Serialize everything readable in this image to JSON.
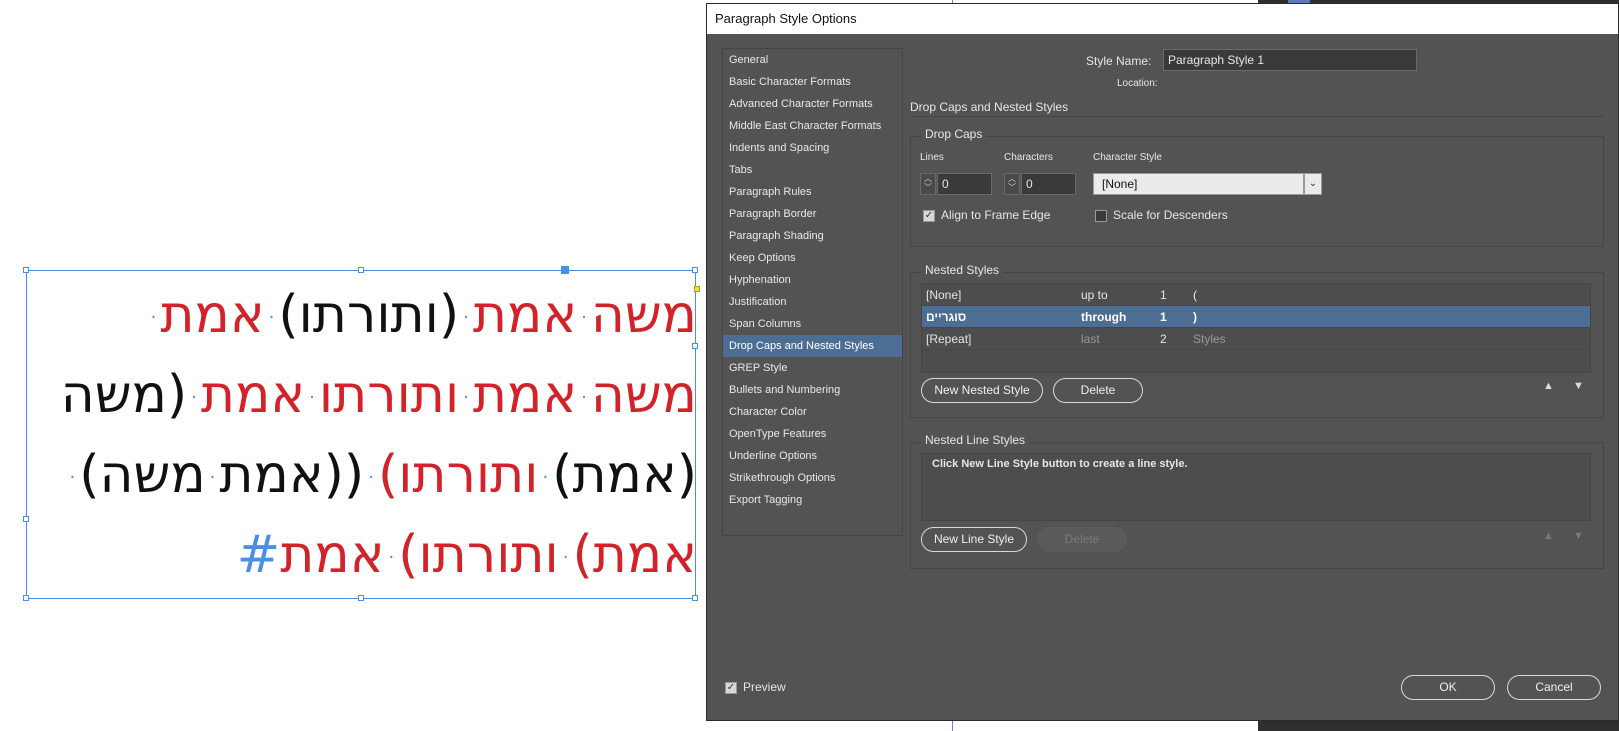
{
  "document": {
    "hebrew_lines": [
      [
        {
          "t": "משה",
          "c": "red"
        },
        {
          "t": "·",
          "c": "dot"
        },
        {
          "t": "אמת",
          "c": "red"
        },
        {
          "t": "·",
          "c": "dot"
        },
        {
          "t": "(ותורתו)",
          "c": "black"
        },
        {
          "t": "·",
          "c": "dot"
        },
        {
          "t": "אמת",
          "c": "red"
        },
        {
          "t": "·",
          "c": "dot"
        }
      ],
      [
        {
          "t": "משה",
          "c": "red"
        },
        {
          "t": "·",
          "c": "dot"
        },
        {
          "t": "אמת",
          "c": "red"
        },
        {
          "t": "·",
          "c": "dot"
        },
        {
          "t": "ותורתו",
          "c": "red"
        },
        {
          "t": "·",
          "c": "dot"
        },
        {
          "t": "אמת",
          "c": "red"
        },
        {
          "t": "·",
          "c": "dot"
        },
        {
          "t": "(משה",
          "c": "black"
        }
      ],
      [
        {
          "t": "(אמת)",
          "c": "black"
        },
        {
          "t": "·",
          "c": "dot"
        },
        {
          "t": "ותורתו)",
          "c": "red"
        },
        {
          "t": "·",
          "c": "dot"
        },
        {
          "t": "((אמת",
          "c": "black"
        },
        {
          "t": "·",
          "c": "dot"
        },
        {
          "t": "משה)",
          "c": "black"
        },
        {
          "t": "·",
          "c": "dot"
        }
      ],
      [
        {
          "t": "אמת)",
          "c": "red"
        },
        {
          "t": "·",
          "c": "dot"
        },
        {
          "t": "ותורתו)",
          "c": "red"
        },
        {
          "t": "·",
          "c": "dot"
        },
        {
          "t": "אמת",
          "c": "red"
        },
        {
          "t": "#",
          "c": "hash"
        }
      ]
    ]
  },
  "dialog": {
    "title": "Paragraph Style Options",
    "style_name_label": "Style Name:",
    "style_name_value": "Paragraph Style 1",
    "location_label": "Location:",
    "section_heading": "Drop Caps and Nested Styles",
    "categories": [
      "General",
      "Basic Character Formats",
      "Advanced Character Formats",
      "Middle East Character Formats",
      "Indents and Spacing",
      "Tabs",
      "Paragraph Rules",
      "Paragraph Border",
      "Paragraph Shading",
      "Keep Options",
      "Hyphenation",
      "Justification",
      "Span Columns",
      "Drop Caps and Nested Styles",
      "GREP Style",
      "Bullets and Numbering",
      "Character Color",
      "OpenType Features",
      "Underline Options",
      "Strikethrough Options",
      "Export Tagging"
    ],
    "selected_category": "Drop Caps and Nested Styles",
    "drop_caps": {
      "title": "Drop Caps",
      "lines_label": "Lines",
      "lines_value": "0",
      "characters_label": "Characters",
      "characters_value": "0",
      "char_style_label": "Character Style",
      "char_style_value": "[None]",
      "align_frame_edge": "Align to Frame Edge",
      "align_checked": true,
      "scale_descenders": "Scale for Descenders",
      "scale_checked": false
    },
    "nested_styles": {
      "title": "Nested Styles",
      "rows": [
        {
          "style": "[None]",
          "mode": "up to",
          "count": "1",
          "delim": "("
        },
        {
          "style": "סוגריים",
          "mode": "through",
          "count": "1",
          "delim": ")"
        },
        {
          "style": "[Repeat]",
          "mode": "last",
          "count": "2",
          "delim": "Styles"
        }
      ],
      "new_button": "New Nested Style",
      "delete_button": "Delete"
    },
    "nested_line_styles": {
      "title": "Nested Line Styles",
      "message": "Click New Line Style button to create a line style.",
      "new_button": "New Line Style",
      "delete_button": "Delete"
    },
    "preview_label": "Preview",
    "preview_checked": true,
    "ok_label": "OK",
    "cancel_label": "Cancel"
  }
}
